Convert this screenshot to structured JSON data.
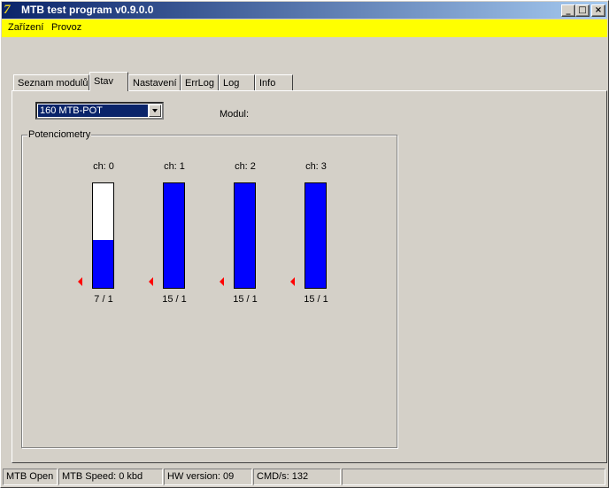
{
  "window": {
    "title": "MTB test program  v0.9.0.0",
    "buttons": {
      "minimize": "_",
      "maximize": "□",
      "close": "×"
    }
  },
  "menu": {
    "items": [
      "Zařízení",
      "Provoz"
    ]
  },
  "tabs": [
    {
      "label": "Seznam modulů",
      "active": false
    },
    {
      "label": "Stav",
      "active": true
    },
    {
      "label": "Nastavení",
      "active": false
    },
    {
      "label": "ErrLog",
      "active": false
    },
    {
      "label": "Log",
      "active": false
    },
    {
      "label": "Info",
      "active": false
    }
  ],
  "stav": {
    "module_select": {
      "value": "160 MTB-POT"
    },
    "modul_label": "Modul:",
    "group_title": "Potenciometry",
    "channels": [
      {
        "label": "ch: 0",
        "value": "7 / 1",
        "level": 0.46
      },
      {
        "label": "ch: 1",
        "value": "15 / 1",
        "level": 1.0
      },
      {
        "label": "ch: 2",
        "value": "15 / 1",
        "level": 1.0
      },
      {
        "label": "ch: 3",
        "value": "15 / 1",
        "level": 1.0
      }
    ],
    "bar_color": "#0000ff",
    "marker_color": "#ff0000"
  },
  "statusbar": {
    "panels": [
      "MTB Open",
      "MTB Speed: 0 kbd",
      "HW version: 09",
      "CMD/s: 132",
      ""
    ]
  },
  "colors": {
    "menubar": "#ffff00",
    "titlebar": "#0a246a",
    "window": "#d4d0c8"
  }
}
